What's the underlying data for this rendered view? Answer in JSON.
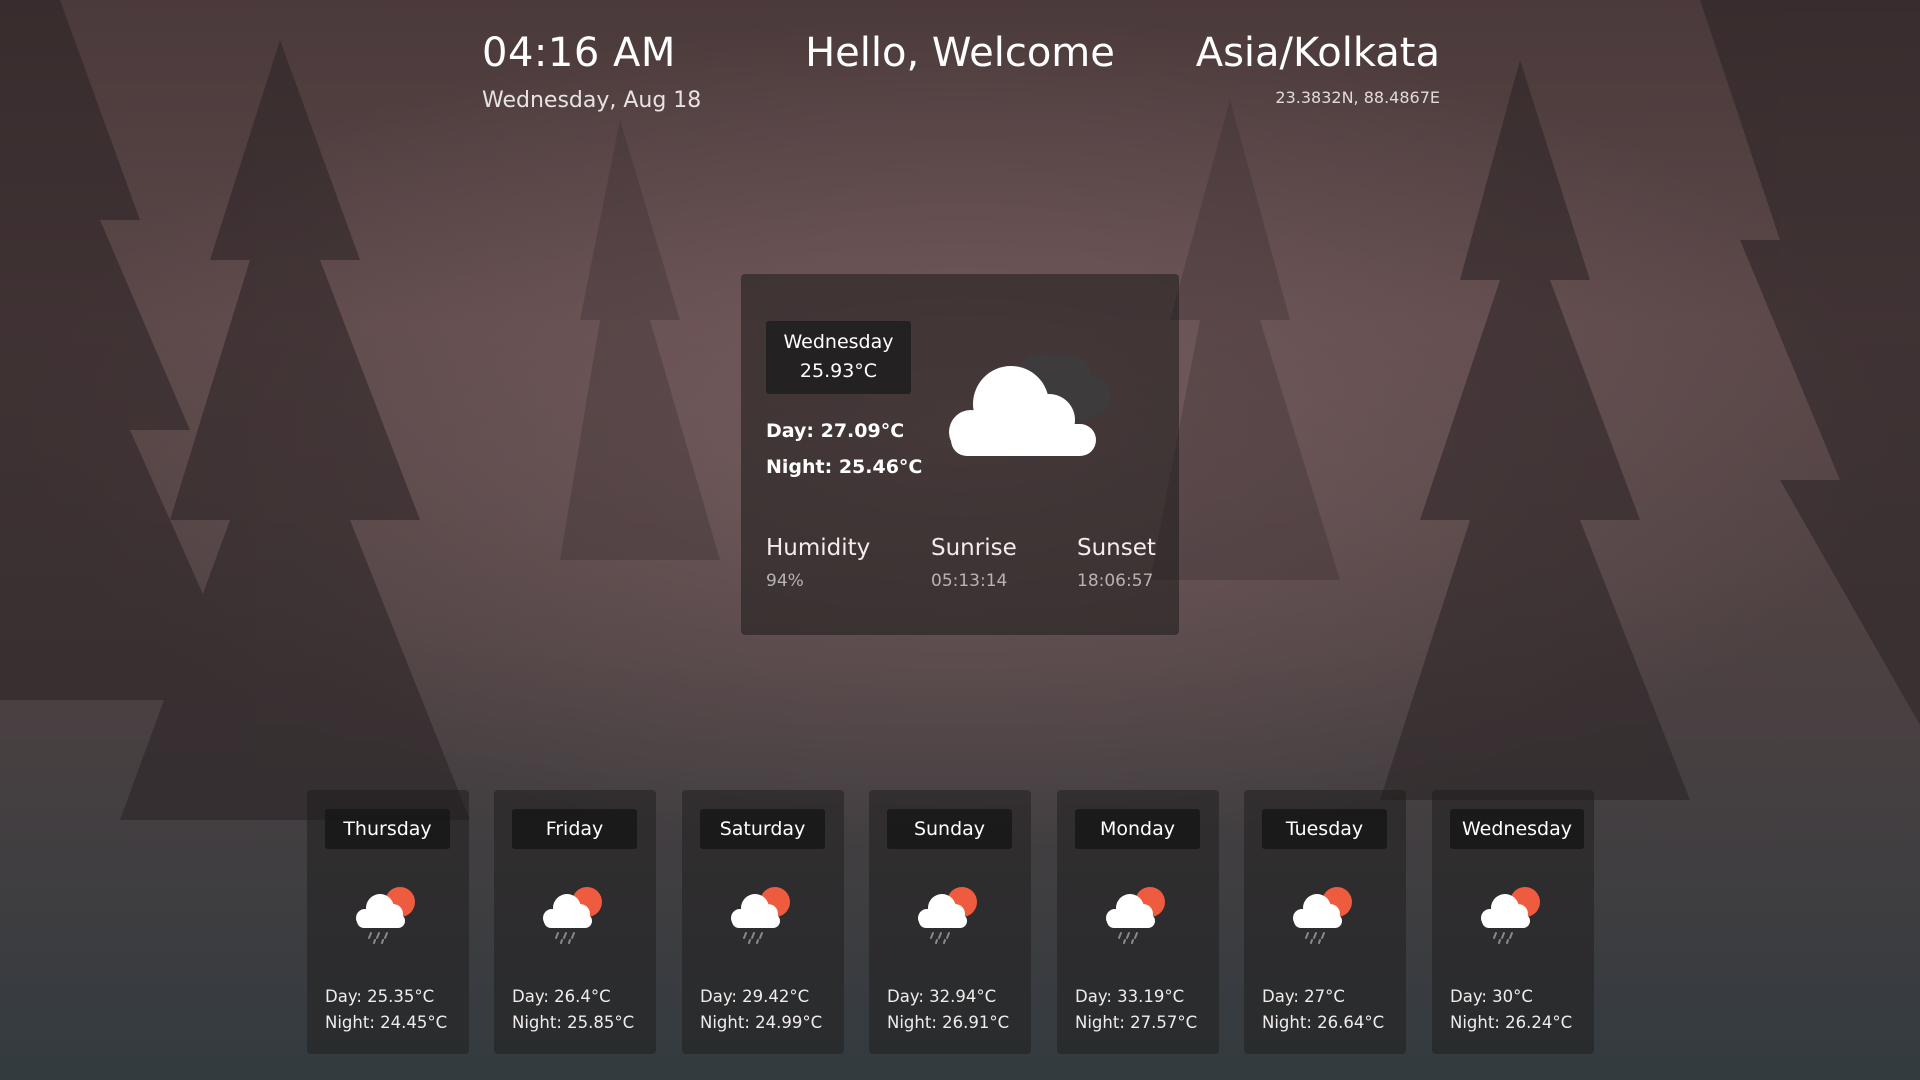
{
  "header": {
    "time": "04:16 AM",
    "date": "Wednesday, Aug 18",
    "greeting": "Hello, Welcome",
    "timezone": "Asia/Kolkata",
    "coordinates": "23.3832N, 88.4867E"
  },
  "today": {
    "day": "Wednesday",
    "temp": "25.93°C",
    "day_temp": "Day: 27.09°C",
    "night_temp": "Night: 25.46°C",
    "icon": "cloudy-icon",
    "humidity_label": "Humidity",
    "humidity_value": "94%",
    "sunrise_label": "Sunrise",
    "sunrise_value": "05:13:14",
    "sunset_label": "Sunset",
    "sunset_value": "18:06:57"
  },
  "forecast": [
    {
      "day": "Thursday",
      "day_temp": "Day: 25.35°C",
      "night_temp": "Night: 24.45°C",
      "icon": "rain-sun-cloud-icon"
    },
    {
      "day": "Friday",
      "day_temp": "Day: 26.4°C",
      "night_temp": "Night: 25.85°C",
      "icon": "rain-sun-cloud-icon"
    },
    {
      "day": "Saturday",
      "day_temp": "Day: 29.42°C",
      "night_temp": "Night: 24.99°C",
      "icon": "rain-sun-cloud-icon"
    },
    {
      "day": "Sunday",
      "day_temp": "Day: 32.94°C",
      "night_temp": "Night: 26.91°C",
      "icon": "rain-sun-cloud-icon"
    },
    {
      "day": "Monday",
      "day_temp": "Day: 33.19°C",
      "night_temp": "Night: 27.57°C",
      "icon": "rain-sun-cloud-icon"
    },
    {
      "day": "Tuesday",
      "day_temp": "Day: 27°C",
      "night_temp": "Night: 26.64°C",
      "icon": "rain-sun-cloud-icon"
    },
    {
      "day": "Wednesday",
      "day_temp": "Day: 30°C",
      "night_temp": "Night: 26.24°C",
      "icon": "rain-sun-cloud-icon"
    }
  ],
  "colors": {
    "sun": "#ef5b3e",
    "cloud": "#ffffff",
    "dark_cloud": "#3d3b3c"
  }
}
